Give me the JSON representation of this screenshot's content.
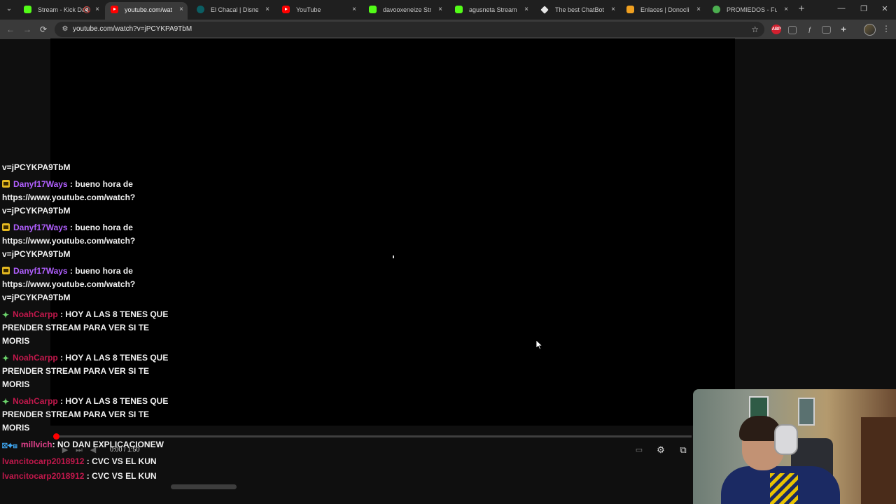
{
  "browser": {
    "tabs": [
      {
        "title": "Stream - Kick Da",
        "favicon": "kick",
        "active": false,
        "muted": true
      },
      {
        "title": "youtube.com/watch?",
        "favicon": "youtube",
        "active": true,
        "muted": false
      },
      {
        "title": "El Chacal | Disney+",
        "favicon": "disney",
        "active": false,
        "muted": false
      },
      {
        "title": "YouTube",
        "favicon": "youtube",
        "active": false,
        "muted": false
      },
      {
        "title": "davooxeneize Stream",
        "favicon": "kick",
        "active": false,
        "muted": false
      },
      {
        "title": "agusneta Stream - W",
        "favicon": "kick",
        "active": false,
        "muted": false
      },
      {
        "title": "The best ChatBot an",
        "favicon": "chatbot",
        "active": false,
        "muted": false
      },
      {
        "title": "Enlaces | Donoclip",
        "favicon": "donoclip",
        "active": false,
        "muted": false
      },
      {
        "title": "PROMIEDOS - Futbo",
        "favicon": "promiedos",
        "active": false,
        "muted": false
      }
    ],
    "url": "youtube.com/watch?v=jPCYKPA9TbM",
    "icons": {
      "tab_close": "×",
      "new_tab": "+",
      "minimize": "—",
      "restore": "❐",
      "window_close": "✕",
      "back": "←",
      "forward": "→",
      "reload": "⟳",
      "site_info": "⚙",
      "bookmark_star": "☆",
      "menu": "⋮",
      "tab_search": "⌄",
      "mute": "🔇"
    }
  },
  "player": {
    "time": "0:00 / 1:50",
    "progress_fraction": 0.0
  },
  "chat": {
    "messages": [
      {
        "badge": "",
        "user": "",
        "text": "v=jPCYKPA9TbM",
        "color": "#f1f1f1"
      },
      {
        "badge": "crown",
        "user": "Danyf17Ways",
        "text": " : bueno hora de https://www.youtube.com/watch?v=jPCYKPA9TbM",
        "color": "#b15fff"
      },
      {
        "badge": "crown",
        "user": "Danyf17Ways",
        "text": " : bueno hora de https://www.youtube.com/watch?v=jPCYKPA9TbM",
        "color": "#b15fff"
      },
      {
        "badge": "crown",
        "user": "Danyf17Ways",
        "text": " : bueno hora de https://www.youtube.com/watch?v=jPCYKPA9TbM",
        "color": "#b15fff"
      },
      {
        "badge": "star",
        "user": "NoahCarpp",
        "text": " : HOY A LAS 8 TENES QUE PRENDER STREAM PARA VER SI TE MORIS",
        "color": "#c2184c"
      },
      {
        "badge": "star",
        "user": "NoahCarpp",
        "text": " : HOY A LAS 8 TENES QUE PRENDER STREAM PARA VER SI TE MORIS",
        "color": "#c2184c"
      },
      {
        "badge": "star",
        "user": "NoahCarpp",
        "text": " : HOY A LAS 8 TENES QUE PRENDER STREAM PARA VER SI TE MORIS",
        "color": "#c2184c"
      },
      {
        "badge": "multi",
        "user": "millvich",
        "text": ": NO DAN EXPLICACIONEW",
        "color": "#e0408a"
      },
      {
        "badge": "",
        "user": "lvancitocarp2018912",
        "text": " : CVC VS EL KUN",
        "color": "#c2184c"
      },
      {
        "badge": "",
        "user": "lvancitocarp2018912",
        "text": " : CVC VS EL KUN",
        "color": "#c2184c"
      }
    ]
  },
  "colors": {
    "accent_red": "#ff0000",
    "kick_green": "#53fc18"
  }
}
